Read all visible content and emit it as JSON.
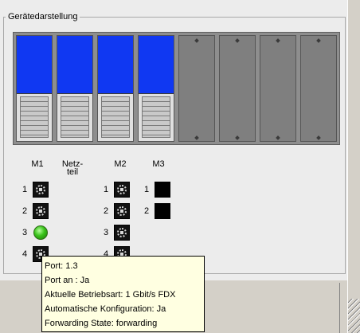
{
  "group_title": "Gerätedarstellung",
  "rack": {
    "slots": [
      {
        "type": "module"
      },
      {
        "type": "module"
      },
      {
        "type": "module"
      },
      {
        "type": "module"
      },
      {
        "type": "empty"
      },
      {
        "type": "empty"
      },
      {
        "type": "empty"
      },
      {
        "type": "empty"
      }
    ],
    "module_color": "#1038f2"
  },
  "modules": {
    "m1": {
      "label": "M1",
      "ports": [
        {
          "num": "1",
          "state": "rj45"
        },
        {
          "num": "2",
          "state": "rj45"
        },
        {
          "num": "3",
          "state": "active"
        },
        {
          "num": "4",
          "state": "rj45"
        }
      ]
    },
    "psu": {
      "label": "Netz-\nteil"
    },
    "m2": {
      "label": "M2",
      "ports": [
        {
          "num": "1",
          "state": "rj45"
        },
        {
          "num": "2",
          "state": "rj45"
        },
        {
          "num": "3",
          "state": "rj45"
        },
        {
          "num": "4",
          "state": "rj45"
        }
      ]
    },
    "m3": {
      "label": "M3",
      "ports": [
        {
          "num": "1",
          "state": "fiber"
        },
        {
          "num": "2",
          "state": "fiber"
        }
      ]
    }
  },
  "tooltip": {
    "port": "Port: 1.3",
    "port_on": "Port an : Ja",
    "mode": "Aktuelle Betriebsart: 1 Gbit/s FDX",
    "autoconf": "Automatische Konfiguration: Ja",
    "forwarding": "Forwarding State: forwarding"
  }
}
